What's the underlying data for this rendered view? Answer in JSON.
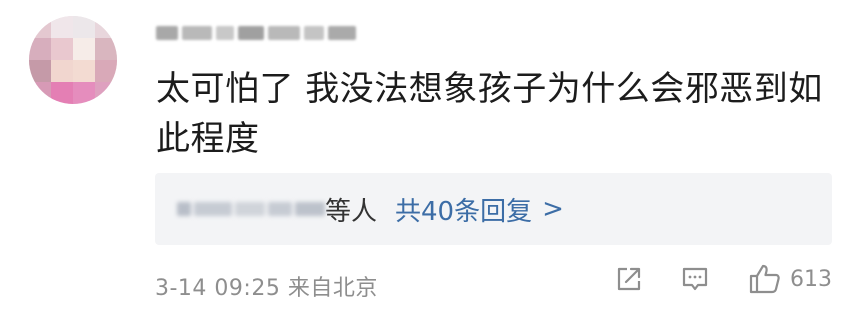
{
  "comment": {
    "username": "",
    "text": "太可怕了 我没法想象孩子为什么会邪恶到如此程度",
    "replies": {
      "names": "",
      "suffix": "等人",
      "count_label": "共40条回复",
      "chevron": ">"
    },
    "meta": "3-14 09:25 来自北京",
    "like_count": "613"
  },
  "icons": {
    "share": "share-icon",
    "comment": "comment-icon",
    "like": "thumbs-up-icon"
  },
  "colors": {
    "link": "#3c6da6",
    "meta_gray": "#8e8e8e",
    "reply_bg": "#f3f4f6"
  }
}
